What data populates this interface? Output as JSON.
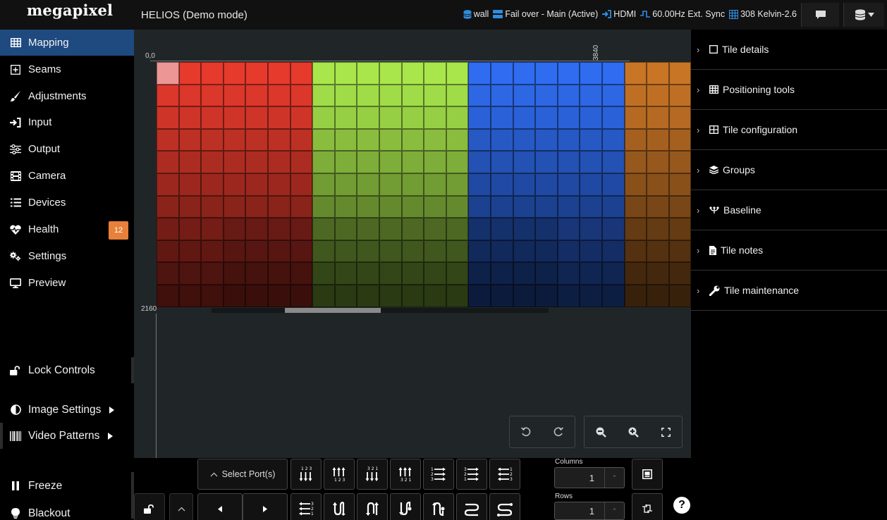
{
  "app": {
    "logo": "megapixel",
    "title": "HELIOS (Demo mode)"
  },
  "status": {
    "wall": "wall",
    "failover": "Fail over - Main (Active)",
    "input": "HDMI",
    "sync": "60.00Hz Ext. Sync",
    "kelvin": "308 Kelvin-2.6"
  },
  "sidebar": {
    "items": [
      {
        "label": "Mapping",
        "icon": "grid-icon"
      },
      {
        "label": "Seams",
        "icon": "plus-square-icon"
      },
      {
        "label": "Adjustments",
        "icon": "brush-icon"
      },
      {
        "label": "Input",
        "icon": "sign-in-icon"
      },
      {
        "label": "Output",
        "icon": "sliders-icon"
      },
      {
        "label": "Camera",
        "icon": "film-icon"
      },
      {
        "label": "Devices",
        "icon": "list-icon"
      },
      {
        "label": "Health",
        "icon": "heartbeat-icon",
        "badge": "12"
      },
      {
        "label": "Settings",
        "icon": "cogs-icon"
      },
      {
        "label": "Preview",
        "icon": "monitor-icon"
      }
    ],
    "lock_label": "Lock Controls",
    "image_settings_label": "Image Settings",
    "video_patterns_label": "Video Patterns",
    "freeze_label": "Freeze",
    "blackout_label": "Blackout"
  },
  "canvas": {
    "origin_label": "0,0",
    "width_label": "3840",
    "height_label": "2160"
  },
  "right_panel": {
    "sections": [
      {
        "label": "Tile details",
        "icon": "square-icon"
      },
      {
        "label": "Positioning tools",
        "icon": "grid-icon"
      },
      {
        "label": "Tile configuration",
        "icon": "table-icon"
      },
      {
        "label": "Groups",
        "icon": "layers-icon"
      },
      {
        "label": "Baseline",
        "icon": "baseline-icon"
      },
      {
        "label": "Tile notes",
        "icon": "note-icon"
      },
      {
        "label": "Tile maintenance",
        "icon": "wrench-icon"
      }
    ]
  },
  "bottom": {
    "select_ports_label": "Select Port(s)",
    "columns_label": "Columns",
    "columns_value": "1",
    "rows_label": "Rows",
    "rows_value": "1",
    "help": "?"
  },
  "colors": {
    "active_nav": "#1f4a80",
    "badge": "#e8803a",
    "red": "#e63a2c",
    "green": "#a8e64c",
    "blue": "#2f6cf0",
    "orange": "#c97526"
  }
}
